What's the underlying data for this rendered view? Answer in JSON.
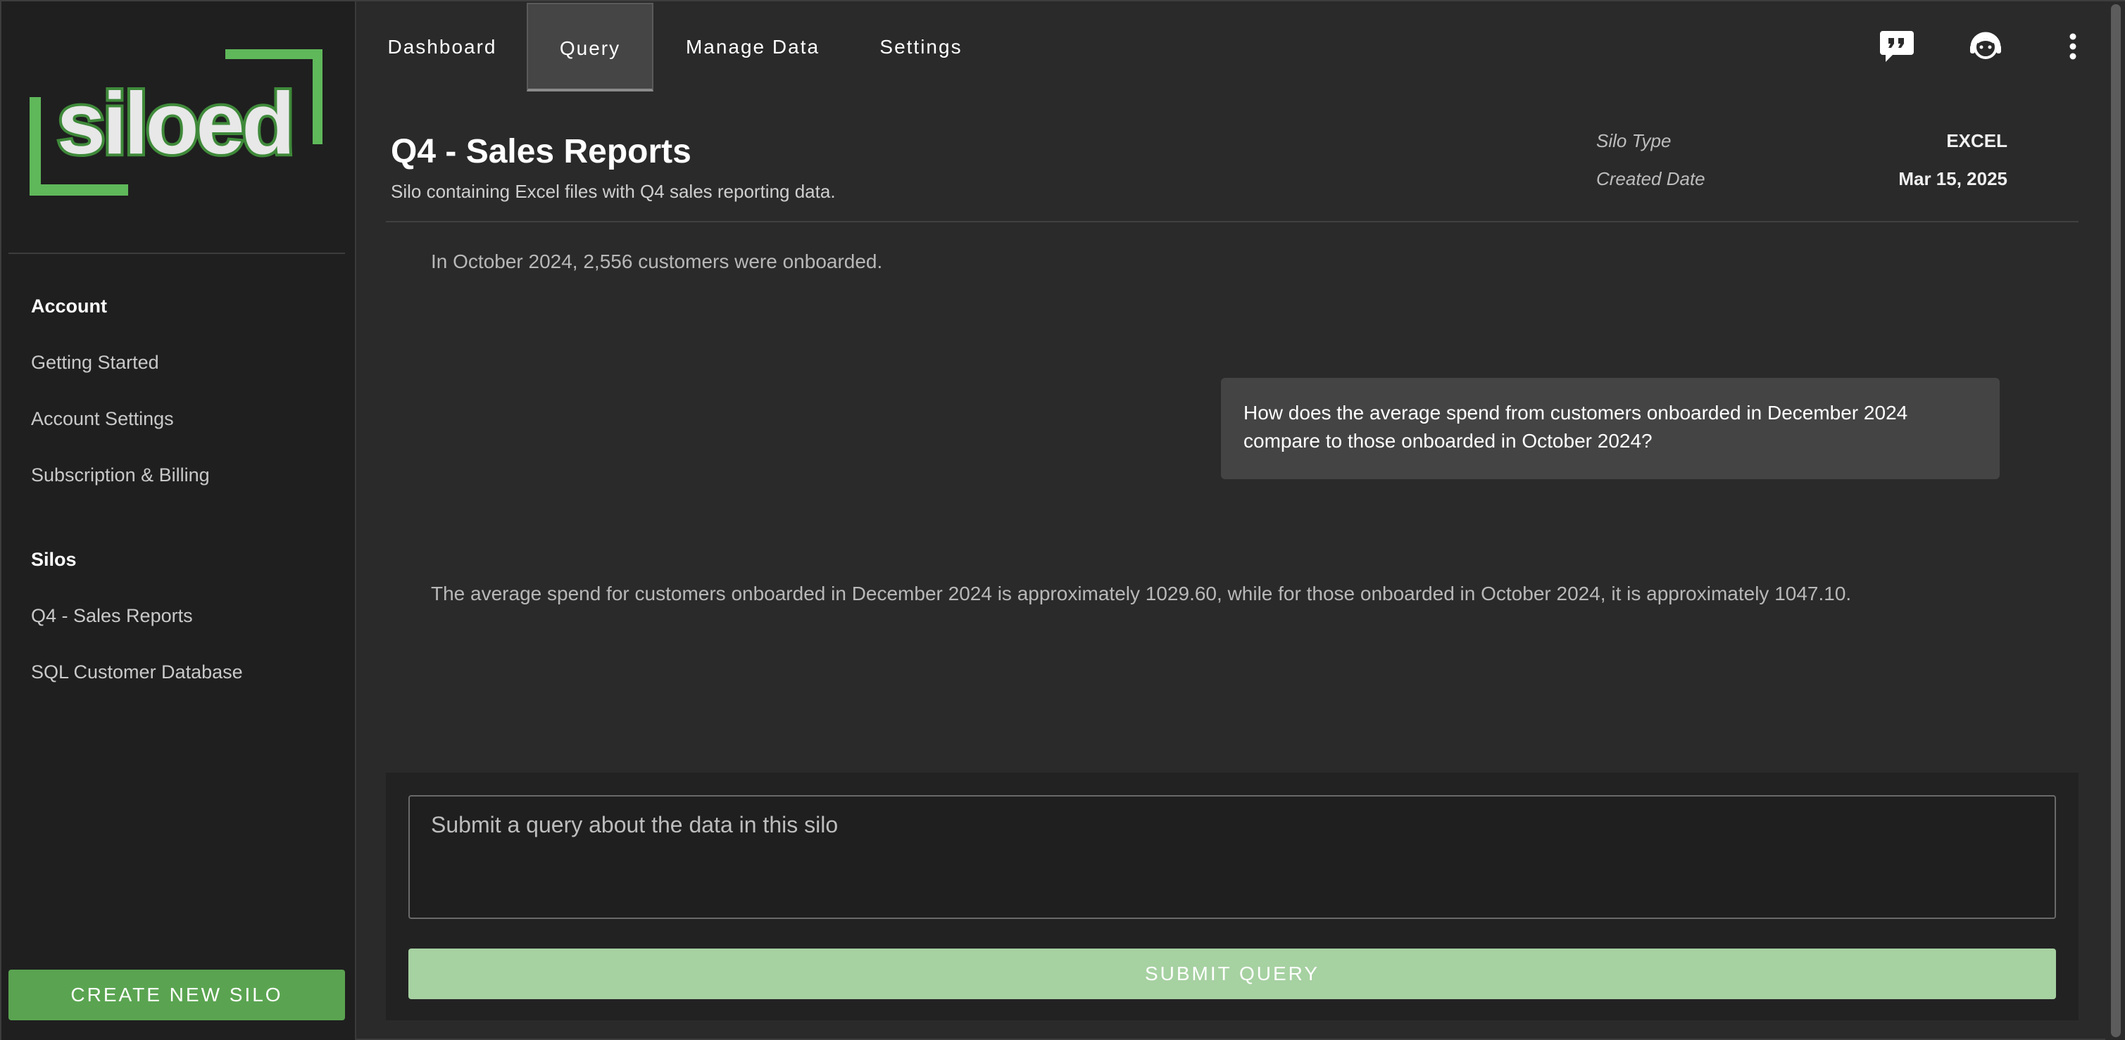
{
  "app": {
    "logo_text": "siloed",
    "brand_color": "#5aa451"
  },
  "sidebar": {
    "groups": [
      {
        "title": "Account",
        "items": [
          "Getting Started",
          "Account Settings",
          "Subscription & Billing"
        ]
      },
      {
        "title": "Silos",
        "items": [
          "Q4 - Sales Reports",
          "SQL Customer Database"
        ]
      }
    ],
    "create_button": "CREATE NEW SILO"
  },
  "topnav": {
    "tabs": [
      {
        "label": "Dashboard",
        "active": false
      },
      {
        "label": "Query",
        "active": true
      },
      {
        "label": "Manage Data",
        "active": false
      },
      {
        "label": "Settings",
        "active": false
      }
    ],
    "icons": [
      "feedback-quote-icon",
      "support-agent-icon",
      "more-vertical-icon"
    ]
  },
  "silo": {
    "title": "Q4 - Sales Reports",
    "description": "Silo containing Excel files with Q4 sales reporting data.",
    "meta": [
      {
        "label": "Silo Type",
        "value": "EXCEL"
      },
      {
        "label": "Created Date",
        "value": "Mar 15, 2025"
      }
    ]
  },
  "conversation": [
    {
      "role": "assistant",
      "text": "In October 2024, 2,556 customers were onboarded."
    },
    {
      "role": "user",
      "text": "How does the average spend from customers onboarded in December 2024 compare to those onboarded in October 2024?"
    },
    {
      "role": "assistant",
      "text": "The average spend for customers onboarded in December 2024 is approximately 1029.60, while for those onboarded in October 2024, it is approximately 1047.10."
    }
  ],
  "query": {
    "placeholder": "Submit a query about the data in this silo",
    "value": "",
    "submit_label": "SUBMIT QUERY"
  }
}
